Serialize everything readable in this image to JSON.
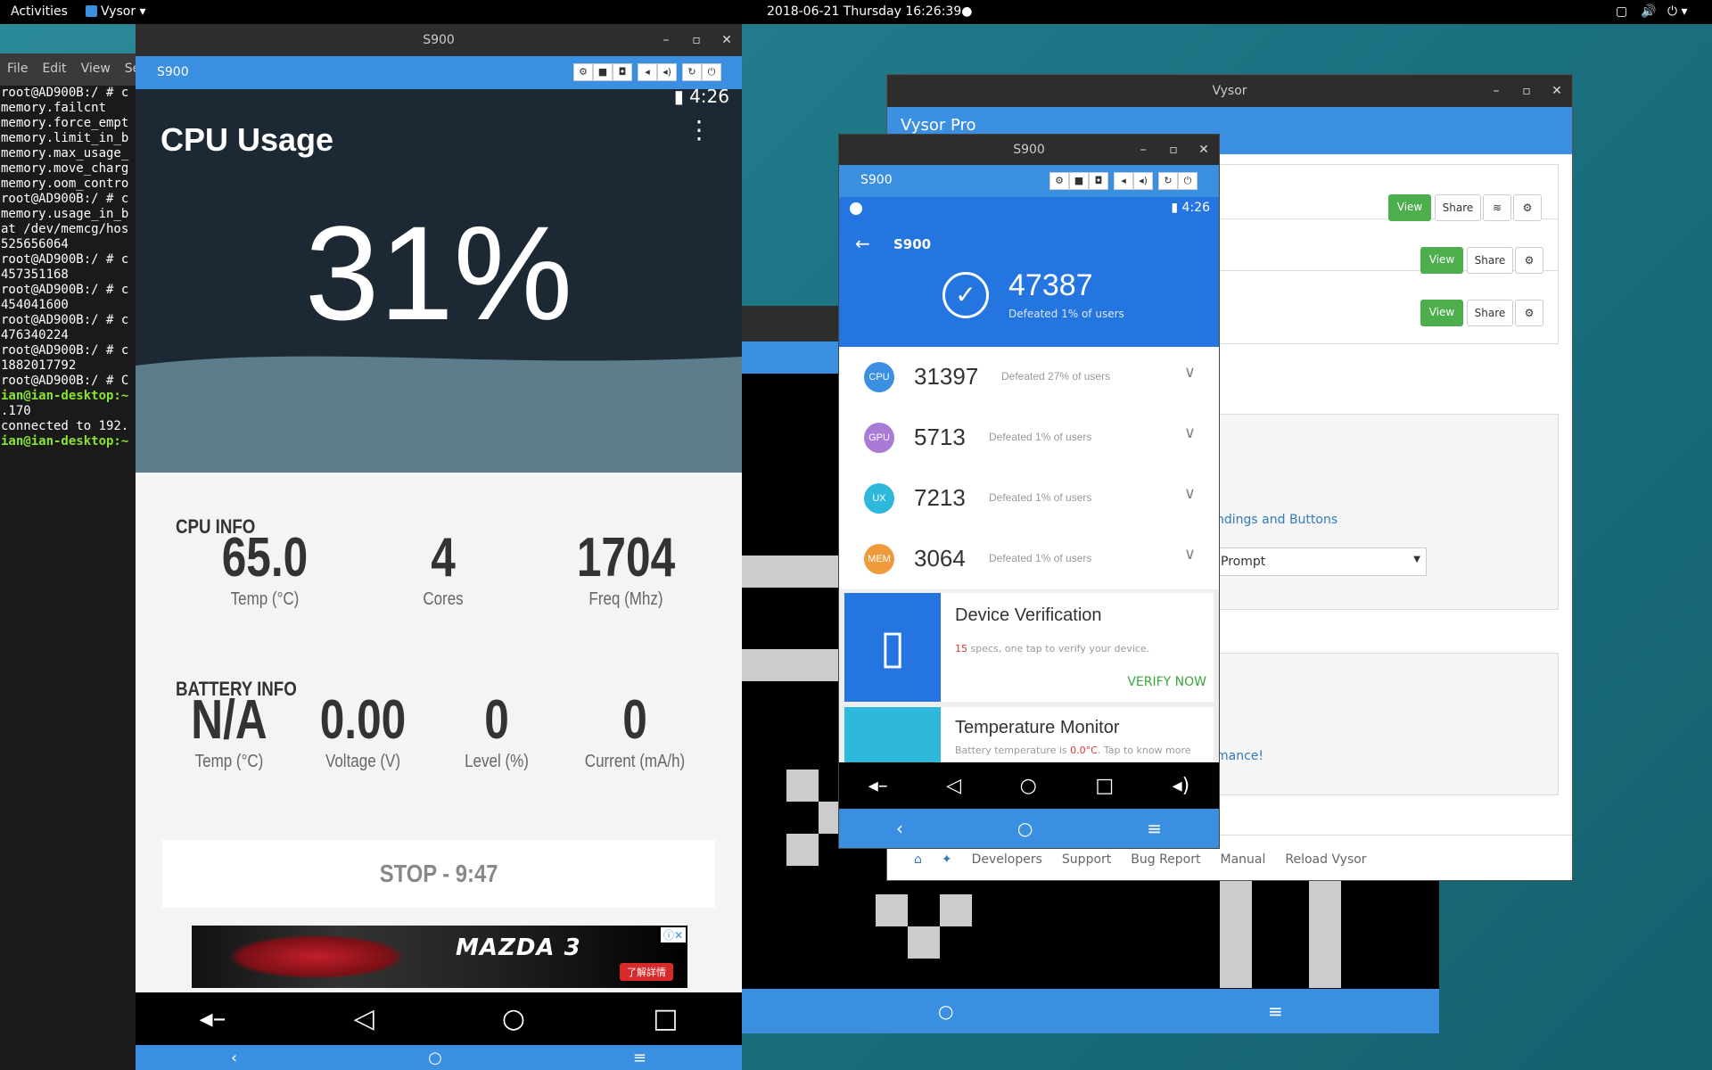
{
  "topbar": {
    "activities": "Activities",
    "app": "Vysor ▾",
    "clock": "2018-06-21 Thursday 16:26:39●",
    "icons": [
      "window-icon",
      "volume-icon",
      "power-icon"
    ]
  },
  "terminal": {
    "menu": [
      "File",
      "Edit",
      "View",
      "Se"
    ],
    "lines": [
      "root@AD900B:/ # c",
      "memory.failcnt",
      "memory.force_empt",
      "memory.limit_in_b",
      "memory.max_usage_",
      "memory.move_charg",
      "memory.oom_contro",
      "root@AD900B:/ # c",
      "memory.usage_in_b",
      "at /dev/memcg/hos",
      "525656064",
      "root@AD900B:/ # c",
      "457351168",
      "root@AD900B:/ # c",
      "454041600",
      "root@AD900B:/ # c",
      "476340224",
      "root@AD900B:/ # c",
      "1882017792",
      "root@AD900B:/ # C"
    ],
    "prompt1": "ian@ian-desktop:~",
    "line_ip": ".170",
    "connected": "connected to 192.",
    "prompt2": "ian@ian-desktop:~"
  },
  "win1": {
    "title": "S900",
    "vysor_label": "S900",
    "status_time": "4:26",
    "app_title": "CPU Usage",
    "usage": "31%",
    "cpu_info_title": "CPU INFO",
    "cpu_stats": [
      {
        "value": "65.0",
        "label": "Temp (°C)"
      },
      {
        "value": "4",
        "label": "Cores"
      },
      {
        "value": "1704",
        "label": "Freq (Mhz)"
      }
    ],
    "battery_info_title": "BATTERY INFO",
    "battery_stats": [
      {
        "value": "N/A",
        "label": "Temp (°C)"
      },
      {
        "value": "0.00",
        "label": "Voltage (V)"
      },
      {
        "value": "0",
        "label": "Level (%)"
      },
      {
        "value": "0",
        "label": "Current (mA/h)"
      }
    ],
    "stop_button": "STOP - 9:47",
    "ad": {
      "brand": "MAZDA 3",
      "tag": "了解詳情"
    }
  },
  "vysor": {
    "title": "Vysor",
    "header": "Vysor Pro",
    "buttons": {
      "view": "View",
      "share": "Share"
    },
    "link1": "ndings and Buttons",
    "select_value": "Prompt",
    "link2": "mance!",
    "footer": [
      "Developers",
      "Support",
      "Bug Report",
      "Manual",
      "Reload Vysor"
    ]
  },
  "win2": {
    "title": "S900",
    "vysor_label": "S900",
    "status_time": "4:26",
    "app_title": "S900",
    "score": "47387",
    "score_sub": "Defeated 1% of users",
    "rows": [
      {
        "badge": "CPU",
        "value": "31397",
        "sub": "Defeated 27% of users",
        "color": "#3b8fe0"
      },
      {
        "badge": "GPU",
        "value": "5713",
        "sub": "Defeated 1% of users",
        "color": "#a97bd6"
      },
      {
        "badge": "UX",
        "value": "7213",
        "sub": "Defeated 1% of users",
        "color": "#2db8dc"
      },
      {
        "badge": "MEM",
        "value": "3064",
        "sub": "Defeated 1% of users",
        "color": "#f09a3e"
      }
    ],
    "card1": {
      "title": "Device Verification",
      "count": "15",
      "desc": " specs, one tap to verify your device.",
      "action": "VERIFY NOW"
    },
    "card2": {
      "title": "Temperature Monitor",
      "desc_pre": "Battery temperature is ",
      "temp": "0.0°C",
      "desc_post": ". Tap to know more"
    }
  }
}
